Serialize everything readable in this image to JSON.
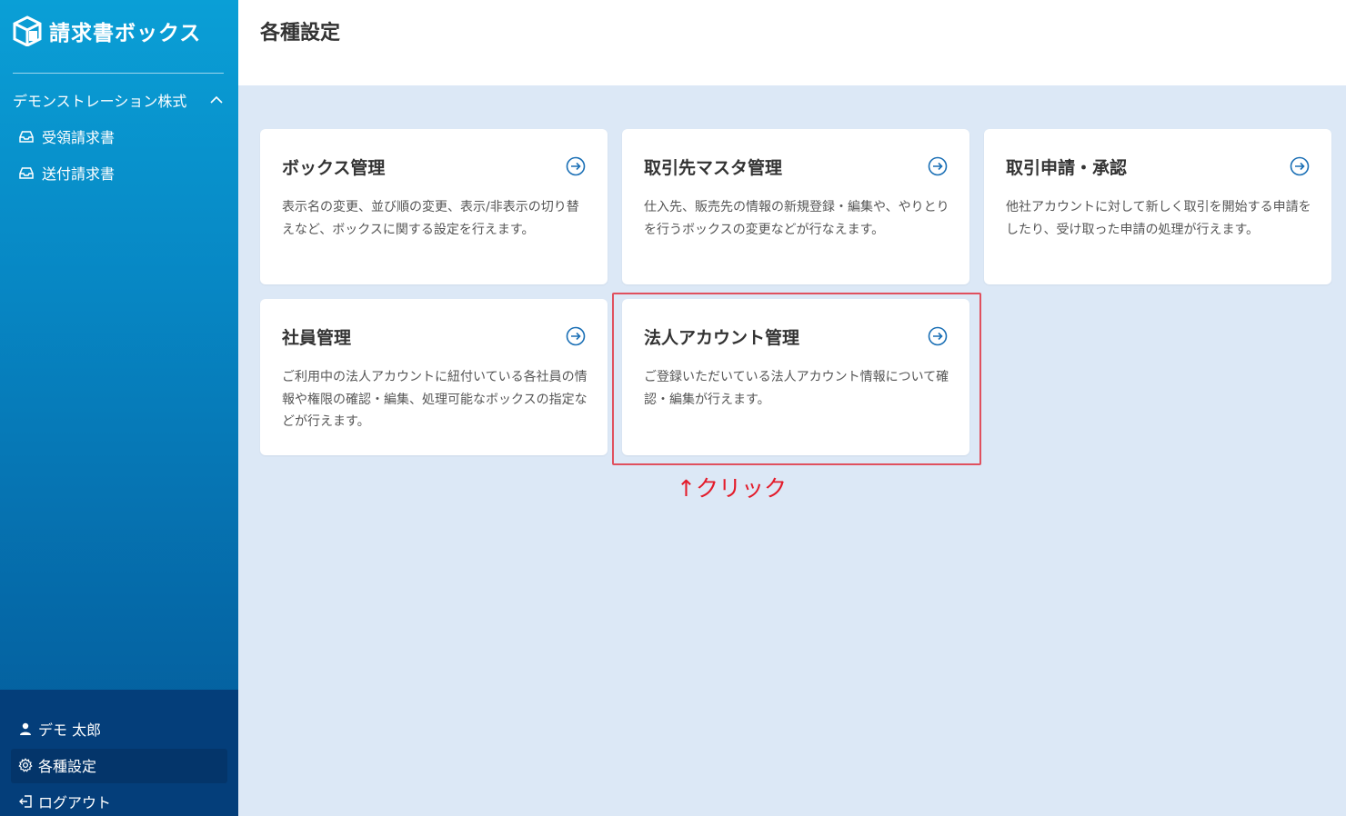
{
  "app": {
    "name": "請求書ボックス"
  },
  "sidebar": {
    "company": "デモンストレーション株式",
    "items": [
      {
        "label": "受領請求書",
        "icon": "inbox-icon"
      },
      {
        "label": "送付請求書",
        "icon": "inbox-icon"
      }
    ],
    "bottom": [
      {
        "label": "デモ 太郎",
        "icon": "user-icon"
      },
      {
        "label": "各種設定",
        "icon": "gear-icon"
      },
      {
        "label": "ログアウト",
        "icon": "logout-icon"
      }
    ]
  },
  "header": {
    "title": "各種設定"
  },
  "cards": [
    {
      "title": "ボックス管理",
      "desc": "表示名の変更、並び順の変更、表示/非表示の切り替えなど、ボックスに関する設定を行えます。"
    },
    {
      "title": "取引先マスタ管理",
      "desc": "仕入先、販売先の情報の新規登録・編集や、やりとりを行うボックスの変更などが行なえます。"
    },
    {
      "title": "取引申請・承認",
      "desc": "他社アカウントに対して新しく取引を開始する申請をしたり、受け取った申請の処理が行えます。"
    },
    {
      "title": "社員管理",
      "desc": "ご利用中の法人アカウントに紐付いている各社員の情報や権限の確認・編集、処理可能なボックスの指定などが行えます。"
    },
    {
      "title": "法人アカウント管理",
      "desc": "ご登録いただいている法人アカウント情報について確認・編集が行えます。"
    }
  ],
  "annotation": {
    "text": "↑クリック",
    "color": "#e31b2a"
  },
  "colors": {
    "accent": "#1a6fb5",
    "sidebar_top": "#0a9fd6",
    "sidebar_bottom": "#043e7a",
    "background": "#dce8f6"
  }
}
